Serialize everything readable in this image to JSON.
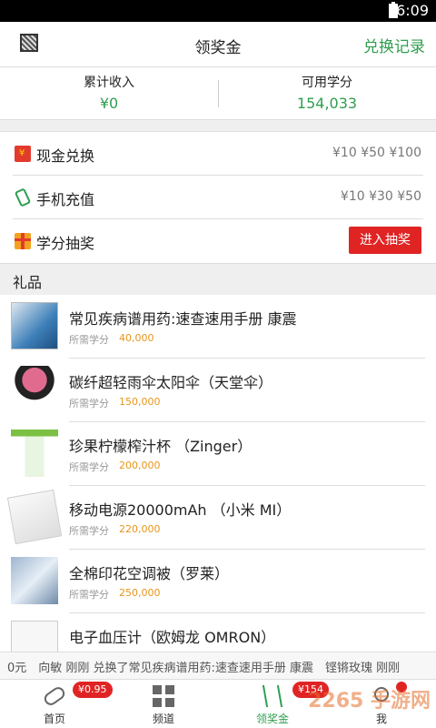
{
  "status": {
    "time": "6:09"
  },
  "header": {
    "title": "领奖金",
    "record": "兑换记录"
  },
  "summary": {
    "income_label": "累计收入",
    "income_value": "¥0",
    "points_label": "可用学分",
    "points_value": "154,033"
  },
  "options": [
    {
      "name": "现金兑换",
      "right": "¥10 ¥50 ¥100",
      "icon": "red-envelope-icon"
    },
    {
      "name": "手机充值",
      "right": "¥10 ¥30 ¥50",
      "icon": "phone-icon"
    },
    {
      "name": "学分抽奖",
      "button": "进入抽奖",
      "icon": "gift-icon"
    }
  ],
  "gifts_header": "礼品",
  "need_label": "所需学分",
  "gifts": [
    {
      "name": "常见疾病谱用药:速查速用手册 康震",
      "points": "40,000"
    },
    {
      "name": "碳纤超轻雨伞太阳伞（天堂伞）",
      "points": "150,000"
    },
    {
      "name": "珍果柠檬榨汁杯 （Zinger）",
      "points": "200,000"
    },
    {
      "name": "移动电源20000mAh （小米 MI）",
      "points": "220,000"
    },
    {
      "name": "全棉印花空调被（罗莱）",
      "points": "250,000"
    },
    {
      "name": "电子血压计（欧姆龙 OMRON）",
      "points": ""
    }
  ],
  "ticker": "0元　向敏 刚刚 兑换了常见疾病谱用药:速查速用手册 康震　铿锵玫瑰 刚刚",
  "tabs": [
    {
      "label": "首页",
      "badge": "¥0.95"
    },
    {
      "label": "频道",
      "badge": ""
    },
    {
      "label": "领奖金",
      "badge": "¥154"
    },
    {
      "label": "我",
      "badge": ""
    }
  ],
  "watermark": "2265 手游网"
}
